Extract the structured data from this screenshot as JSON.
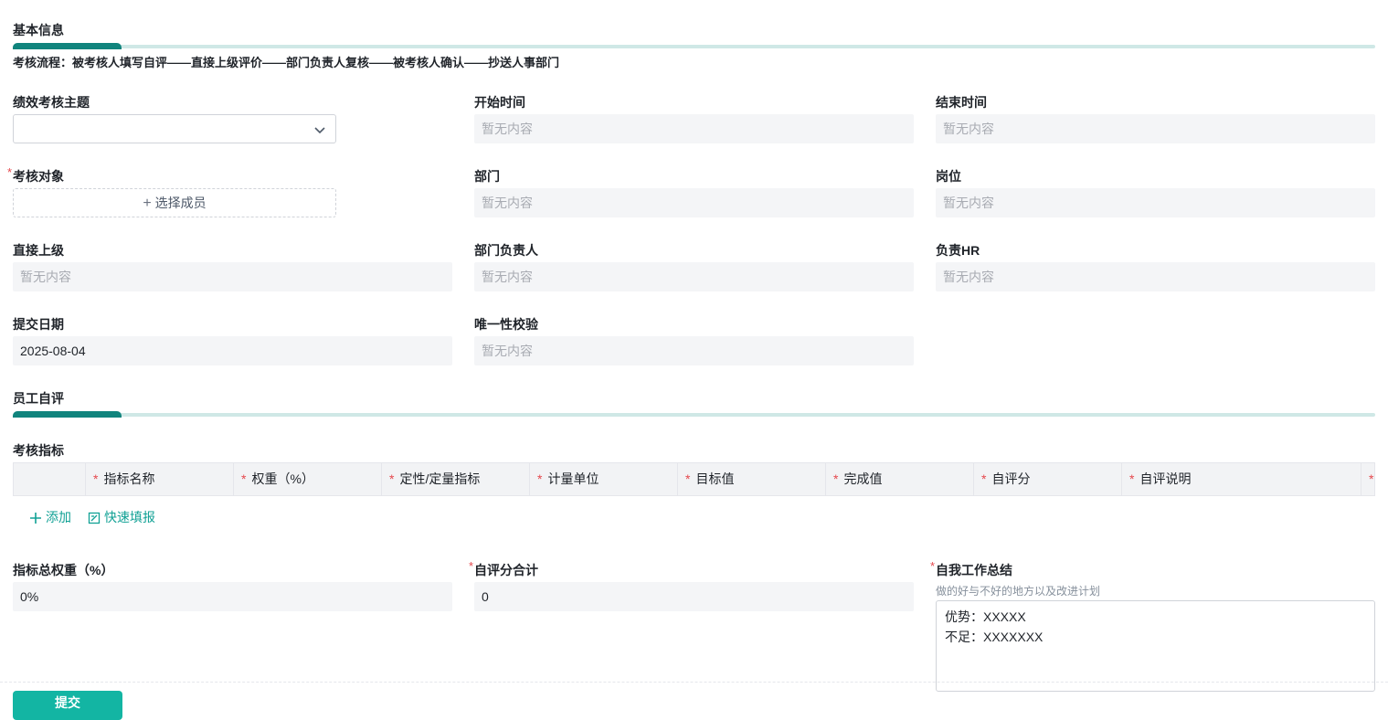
{
  "sections": {
    "basic_info": "基本信息",
    "self_eval": "员工自评"
  },
  "flow_text": "考核流程：被考核人填写自评——直接上级评价——部门负责人复核——被考核人确认——抄送人事部门",
  "placeholder": "暂无内容",
  "fields": {
    "theme": {
      "label": "绩效考核主题"
    },
    "start_time": {
      "label": "开始时间"
    },
    "end_time": {
      "label": "结束时间"
    },
    "target": {
      "label": "考核对象",
      "button": "选择成员"
    },
    "department": {
      "label": "部门"
    },
    "position": {
      "label": "岗位"
    },
    "direct_superior": {
      "label": "直接上级"
    },
    "dept_head": {
      "label": "部门负责人"
    },
    "hr": {
      "label": "负责HR"
    },
    "submit_date": {
      "label": "提交日期",
      "value": "2025-08-04"
    },
    "uniqueness": {
      "label": "唯一性校验"
    }
  },
  "indicators": {
    "label": "考核指标",
    "columns": [
      "指标名称",
      "权重（%）",
      "定性/定量指标",
      "计量单位",
      "目标值",
      "完成值",
      "自评分",
      "自评说明"
    ],
    "add": "添加",
    "quick_fill": "快速填报"
  },
  "totals": {
    "weight": {
      "label": "指标总权重（%）",
      "value": "0%"
    },
    "score": {
      "label": "自评分合计",
      "value": "0"
    },
    "summary": {
      "label": "自我工作总结",
      "hint": "做的好与不好的地方以及改进计划",
      "value": "优势：XXXXX\n不足：XXXXXXX"
    }
  },
  "submit_label": "提交",
  "colors": {
    "accent": "#11847d",
    "button": "#13b5a3",
    "required": "#e5484d"
  },
  "icons": [
    "chevron-down-icon",
    "plus-icon",
    "edit-form-icon"
  ]
}
